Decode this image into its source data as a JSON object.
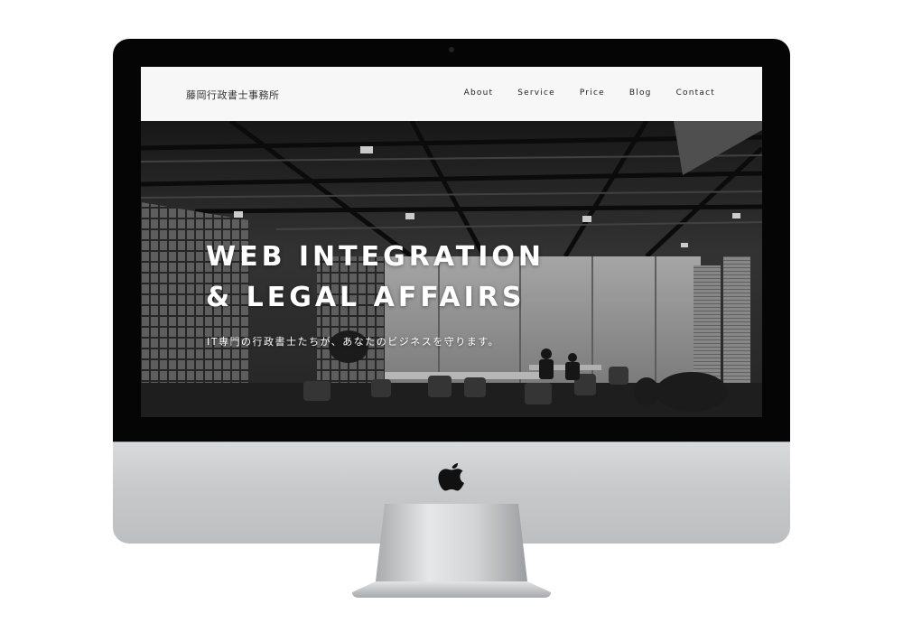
{
  "site": {
    "logo_text": "藤岡行政書士事務所",
    "nav": [
      {
        "label": "About"
      },
      {
        "label": "Service"
      },
      {
        "label": "Price"
      },
      {
        "label": "Blog"
      },
      {
        "label": "Contact"
      }
    ]
  },
  "hero": {
    "title_line1": "WEB INTEGRATION",
    "title_line2": "& LEGAL AFFAIRS",
    "subtitle": "IT専門の行政書士たちが、あなたのビジネスを守ります。"
  },
  "device": {
    "type": "desktop-monitor",
    "logo_icon": "apple-logo-icon"
  },
  "colors": {
    "header_bg": "#f7f7f7",
    "hero_text": "#ffffff",
    "bezel": "#050505"
  }
}
